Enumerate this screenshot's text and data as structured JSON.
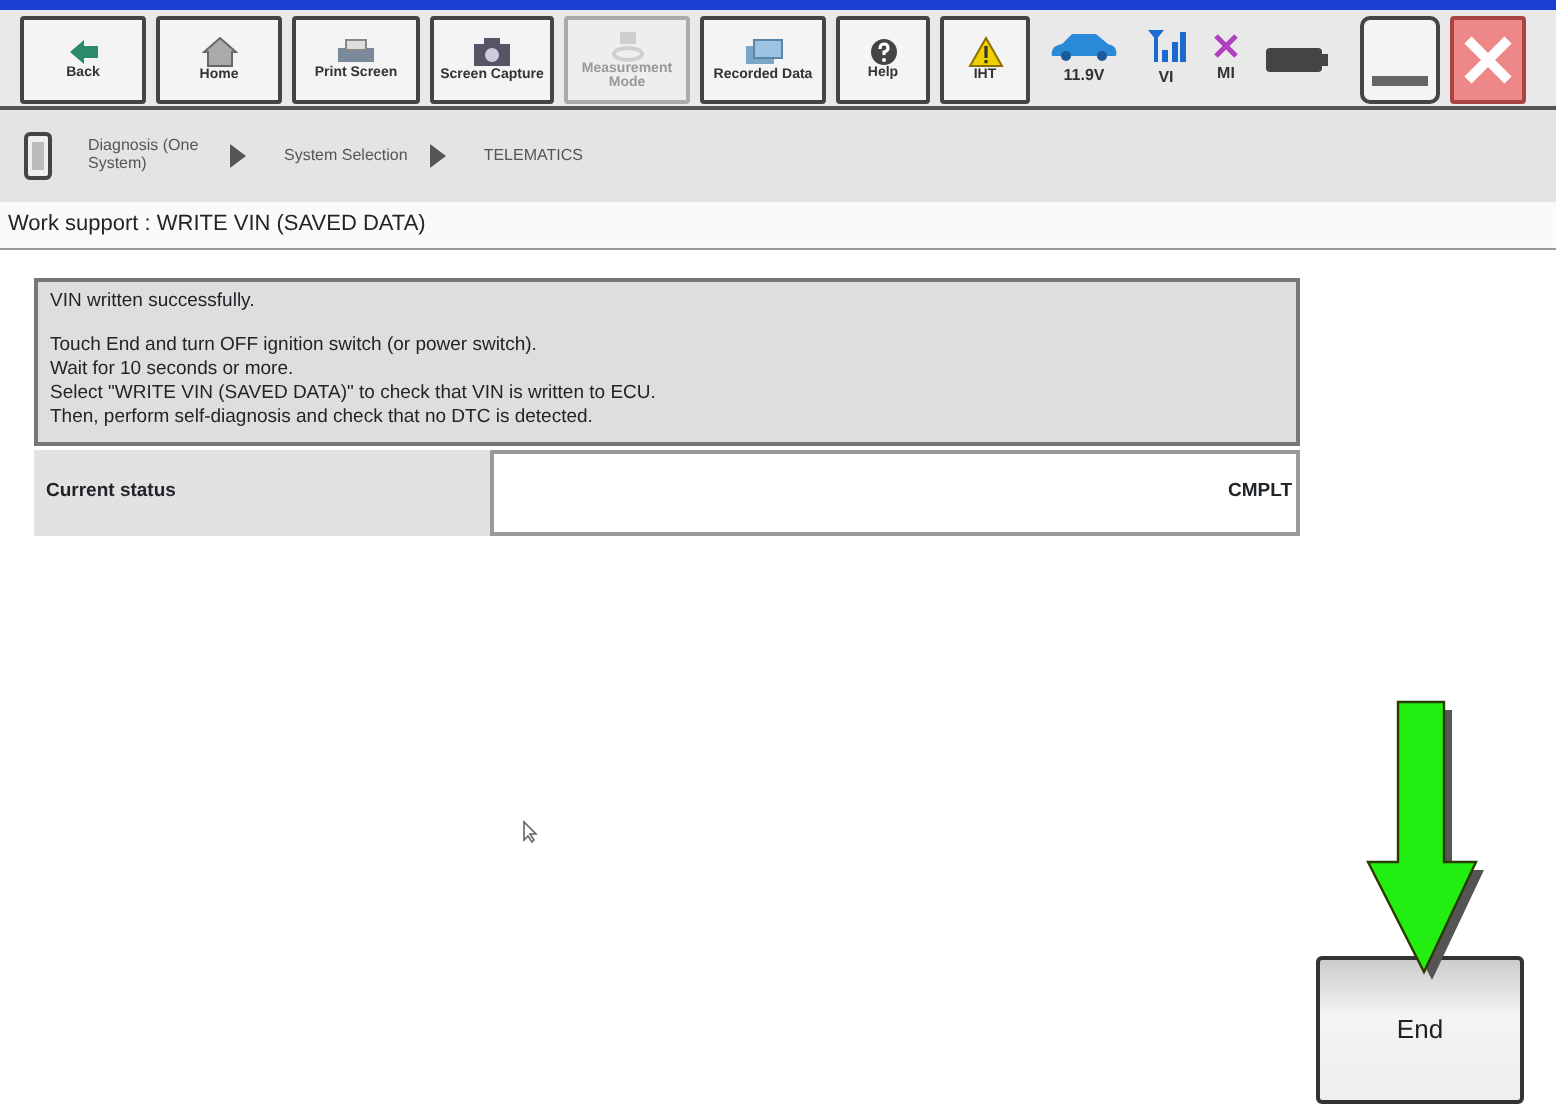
{
  "toolbar": {
    "buttons": [
      {
        "kind": "back",
        "label": "Back",
        "disabled": false
      },
      {
        "kind": "home",
        "label": "Home",
        "disabled": false
      },
      {
        "kind": "print",
        "label": "Print Screen",
        "disabled": false
      },
      {
        "kind": "camera",
        "label": "Screen Capture",
        "disabled": false
      },
      {
        "kind": "measure",
        "label": "Measurement Mode",
        "disabled": true
      },
      {
        "kind": "recorded",
        "label": "Recorded Data",
        "disabled": false
      },
      {
        "kind": "help",
        "label": "Help",
        "disabled": false
      },
      {
        "kind": "warning",
        "label": "IHT",
        "disabled": false
      }
    ],
    "indicators": [
      {
        "kind": "car",
        "label": "11.9V"
      },
      {
        "kind": "signal",
        "label": "VI"
      },
      {
        "kind": "cross",
        "label": "MI"
      },
      {
        "kind": "battery"
      }
    ]
  },
  "breadcrumb": [
    {
      "label": "Diagnosis (One System)"
    },
    {
      "label": "System Selection"
    },
    {
      "label": "TELEMATICS"
    }
  ],
  "page_title": "Work support : WRITE VIN (SAVED DATA)",
  "message": {
    "headline": "VIN written successfully.",
    "lines": [
      "Touch End and turn OFF ignition switch (or power switch).",
      "Wait for 10 seconds or more.",
      "Select \"WRITE VIN (SAVED DATA)\" to check that VIN is written to ECU.",
      "Then, perform self-diagnosis and check that no DTC is detected."
    ]
  },
  "status": {
    "label": "Current status",
    "value": "CMPLT"
  },
  "end_button": {
    "label": "End"
  }
}
